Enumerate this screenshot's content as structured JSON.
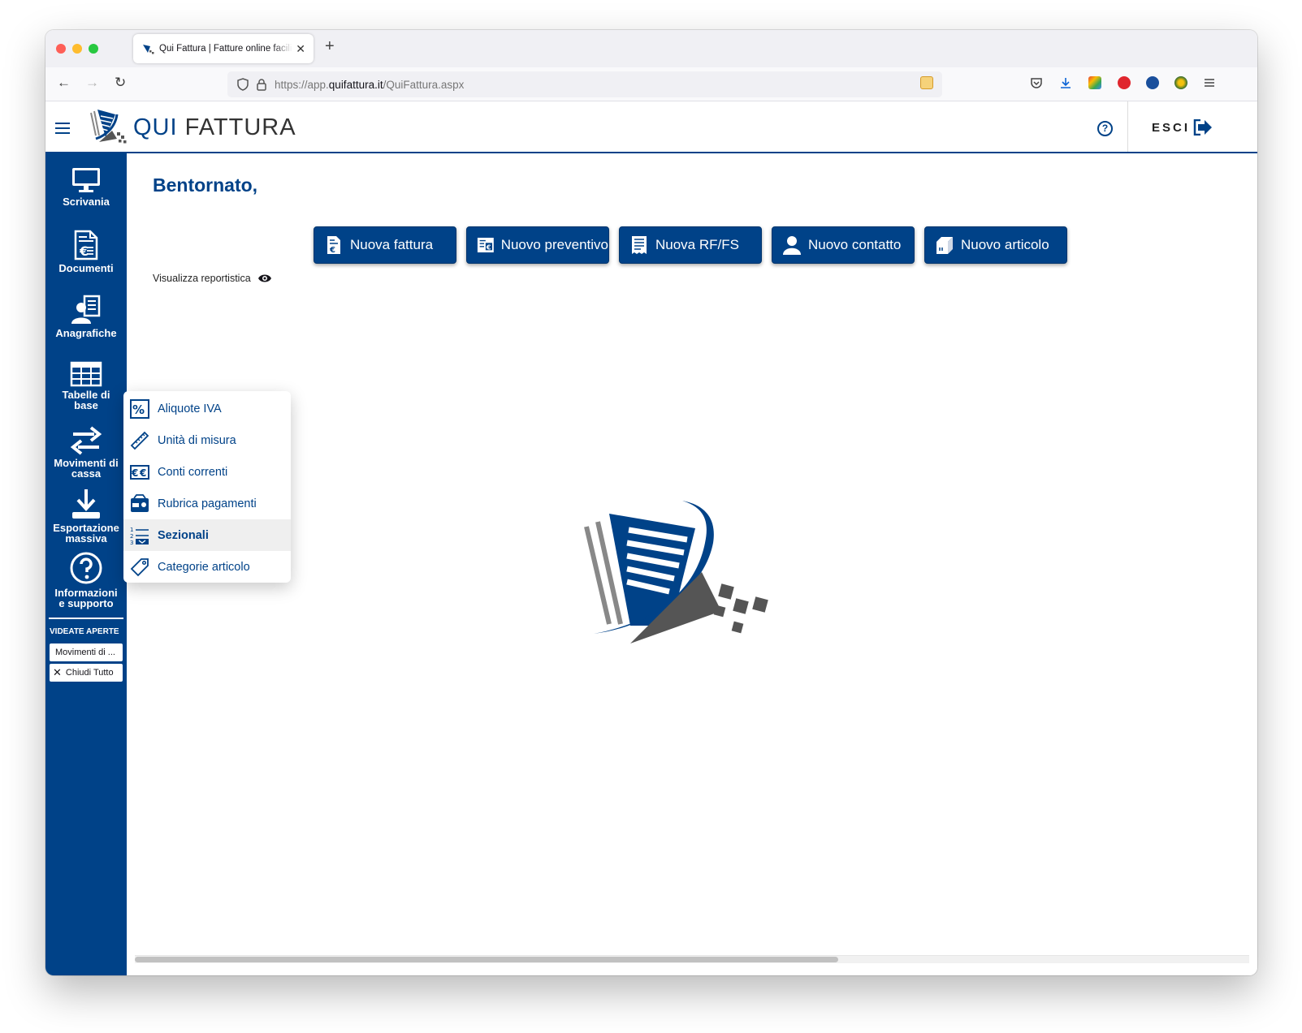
{
  "browser": {
    "tab_title": "Qui Fattura | Fatture online facili",
    "url_prefix": "https://app.",
    "url_domain": "quifattura.it",
    "url_path": "/QuiFattura.aspx"
  },
  "header": {
    "brand_part1": "QUI",
    "brand_part2": "FATTURA",
    "logout_label": "ESCI"
  },
  "sidebar": {
    "items": [
      {
        "label": "Scrivania",
        "icon": "monitor-icon"
      },
      {
        "label": "Documenti",
        "icon": "document-euro-icon"
      },
      {
        "label": "Anagrafiche",
        "icon": "contacts-icon"
      },
      {
        "label_line1": "Tabelle di",
        "label_line2": "base",
        "icon": "table-icon"
      },
      {
        "label_line1": "Movimenti di",
        "label_line2": "cassa",
        "icon": "arrows-exchange-icon"
      },
      {
        "label_line1": "Esportazione",
        "label_line2": "massiva",
        "icon": "download-icon"
      },
      {
        "label_line1": "Informazioni",
        "label_line2": "e supporto",
        "icon": "help-circle-icon"
      }
    ],
    "open_screens_caption": "VIDEATE APERTE",
    "open_screens": [
      "Movimenti di ..."
    ],
    "close_all_label": "Chiudi Tutto"
  },
  "main": {
    "welcome": "Bentornato,",
    "actions": [
      {
        "label": "Nuova fattura",
        "icon": "invoice-icon"
      },
      {
        "label": "Nuovo preventivo",
        "icon": "quote-icon"
      },
      {
        "label": "Nuova RF/FS",
        "icon": "receipt-icon"
      },
      {
        "label": "Nuovo contatto",
        "icon": "user-icon"
      },
      {
        "label": "Nuovo articolo",
        "icon": "package-icon"
      }
    ],
    "report_toggle": "Visualizza reportistica"
  },
  "dropdown": {
    "items": [
      {
        "label": "Aliquote IVA",
        "icon": "percent-icon",
        "active": false
      },
      {
        "label": "Unità di misura",
        "icon": "ruler-icon",
        "active": false
      },
      {
        "label": "Conti correnti",
        "icon": "euro-card-icon",
        "active": false
      },
      {
        "label": "Rubrica pagamenti",
        "icon": "wallet-icon",
        "active": false
      },
      {
        "label": "Sezionali",
        "icon": "numbered-list-icon",
        "active": true
      },
      {
        "label": "Categorie articolo",
        "icon": "tag-icon",
        "active": false
      }
    ]
  },
  "colors": {
    "brand_blue": "#004288",
    "logo_grey": "#555555",
    "link_blue": "#0b63d6"
  }
}
